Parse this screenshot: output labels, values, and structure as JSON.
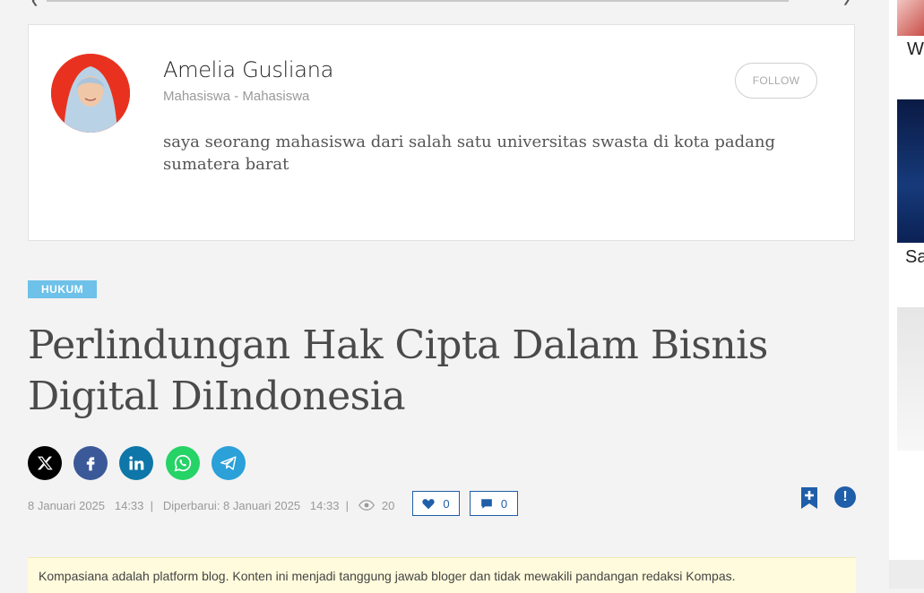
{
  "author": {
    "name": "Amelia Gusliana",
    "role": "Mahasiswa - Mahasiswa",
    "bio": "saya seorang mahasiswa dari salah satu universitas swasta di kota padang sumatera barat",
    "follow_label": "FOLLOW"
  },
  "article": {
    "category": "HUKUM",
    "title": "Perlindungan Hak Cipta Dalam Bisnis Digital DiIndonesia",
    "published_date": "8 Januari 2025",
    "published_time": "14:33",
    "updated_label": "Diperbarui: 8 Januari 2025",
    "updated_time": "14:33",
    "views": "20",
    "likes": "0",
    "comments": "0"
  },
  "share_icons": [
    "x-icon",
    "facebook-icon",
    "linkedin-icon",
    "whatsapp-icon",
    "telegram-icon"
  ],
  "colors": {
    "x": "#000000",
    "facebook": "#3b5998",
    "linkedin": "#0e76a8",
    "whatsapp": "#25d366",
    "telegram": "#2ba0d9",
    "accent": "#1f5ea8",
    "category": "#6ec1e8"
  },
  "disclaimer": "Kompasiana adalah platform blog. Konten ini menjadi tanggung jawab bloger dan tidak mewakili pandangan redaksi Kompas.",
  "sidebar": {
    "item1_text": "W",
    "item2_text": "Sa"
  }
}
